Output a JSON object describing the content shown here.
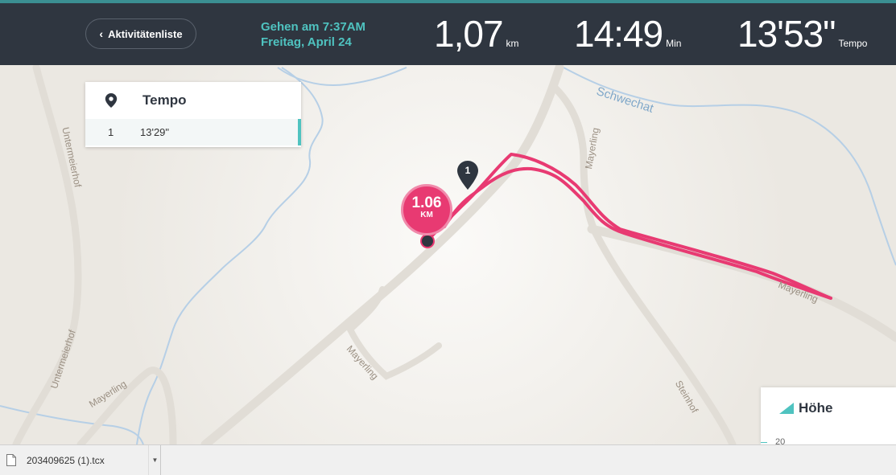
{
  "header": {
    "back_label": "Aktivitätenliste",
    "activity_line1": "Gehen am 7:37AM",
    "activity_line2": "Freitag, April 24",
    "distance": {
      "value": "1,07",
      "unit": "km"
    },
    "duration": {
      "value": "14:49",
      "unit": "Min"
    },
    "pace": {
      "value": "13'53\"",
      "unit": "Tempo"
    }
  },
  "pace_panel": {
    "title": "Tempo",
    "splits": [
      {
        "number": "1",
        "pace": "13'29\""
      }
    ]
  },
  "map": {
    "km_marker": {
      "value": "1.06",
      "unit": "KM"
    },
    "split_marker": "1",
    "labels": {
      "river": "Schwechat",
      "mayerling_top": "Mayerling",
      "untermeierhof_top": "Untermeierhof",
      "untermeierhof_bottom": "Untermeierhof",
      "mayerling_left": "Mayerling",
      "mayerling_center": "Mayerling",
      "steinhof": "Steinhof",
      "mayerling_right": "Mayerling"
    },
    "route_color": "#e83a72"
  },
  "height_panel": {
    "title": "Höhe",
    "tick": "20"
  },
  "download_bar": {
    "file_name": "203409625 (1).tcx"
  },
  "colors": {
    "header_bg": "#2f3640",
    "accent": "#4fc3c0",
    "route": "#e83a72"
  }
}
